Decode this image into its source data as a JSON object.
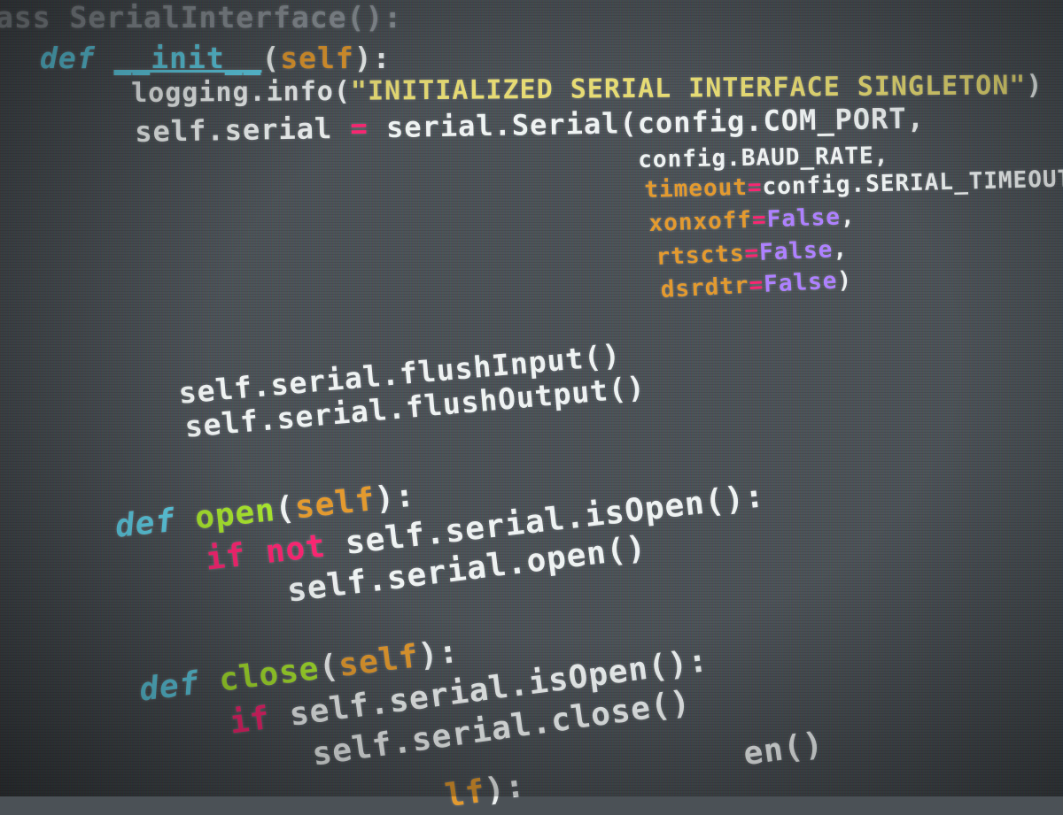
{
  "code": {
    "language": "python",
    "colors": {
      "keyword": "#5fcfe6",
      "function": "#a6e22e",
      "self": "#e39a2f",
      "string": "#e6db74",
      "operator": "#f92672",
      "constant": "#ae81ff",
      "text": "#eef2f2",
      "background": "#4b5156"
    },
    "lines": [
      [
        [
          "class",
          "ass "
        ],
        [
          "class",
          "SerialInterface():"
        ]
      ],
      [
        [
          "kw",
          "def "
        ],
        [
          "fnc",
          "__init__"
        ],
        [
          "plain",
          "("
        ],
        [
          "self",
          "self"
        ],
        [
          "plain",
          "):"
        ]
      ],
      [
        [
          "plain",
          "logging.info("
        ],
        [
          "str",
          "\"INITIALIZED SERIAL INTERFACE SINGLETON\""
        ],
        [
          "plain",
          ")"
        ]
      ],
      [
        [
          "plain",
          "self.serial "
        ],
        [
          "op",
          "="
        ],
        [
          "plain",
          " serial.Serial(config.COM_PORT,"
        ]
      ],
      [
        [
          "plain",
          "config.BAUD_RATE,"
        ]
      ],
      [
        [
          "arg",
          "timeout"
        ],
        [
          "op",
          "="
        ],
        [
          "plain",
          "config.SERIAL_TIMEOUT,"
        ]
      ],
      [
        [
          "arg",
          "xonxoff"
        ],
        [
          "op",
          "="
        ],
        [
          "const",
          "False"
        ],
        [
          "plain",
          ","
        ]
      ],
      [
        [
          "arg",
          "rtscts"
        ],
        [
          "op",
          "="
        ],
        [
          "const",
          "False"
        ],
        [
          "plain",
          ","
        ]
      ],
      [
        [
          "arg",
          "dsrdtr"
        ],
        [
          "op",
          "="
        ],
        [
          "const",
          "False"
        ],
        [
          "plain",
          ")"
        ]
      ],
      [
        [
          "plain",
          "self.serial.flushInput()"
        ]
      ],
      [
        [
          "plain",
          "self.serial.flushOutput()"
        ]
      ],
      [
        [
          "kw",
          "def "
        ],
        [
          "fn",
          "open"
        ],
        [
          "plain",
          "("
        ],
        [
          "self",
          "self"
        ],
        [
          "plain",
          "):"
        ]
      ],
      [
        [
          "ctl",
          "if not "
        ],
        [
          "plain",
          "self.serial.isOpen():"
        ]
      ],
      [
        [
          "plain",
          "self.serial.open()"
        ]
      ],
      [
        [
          "kw",
          "def "
        ],
        [
          "fn",
          "close"
        ],
        [
          "plain",
          "("
        ],
        [
          "self",
          "self"
        ],
        [
          "plain",
          "):"
        ]
      ],
      [
        [
          "ctl",
          "if "
        ],
        [
          "plain",
          "self.serial.isOpen():"
        ]
      ],
      [
        [
          "plain",
          "self.serial.close()"
        ]
      ],
      [
        [
          "self",
          "lf"
        ],
        [
          "plain",
          "):"
        ],
        [
          "plain",
          "           en()"
        ]
      ]
    ]
  }
}
